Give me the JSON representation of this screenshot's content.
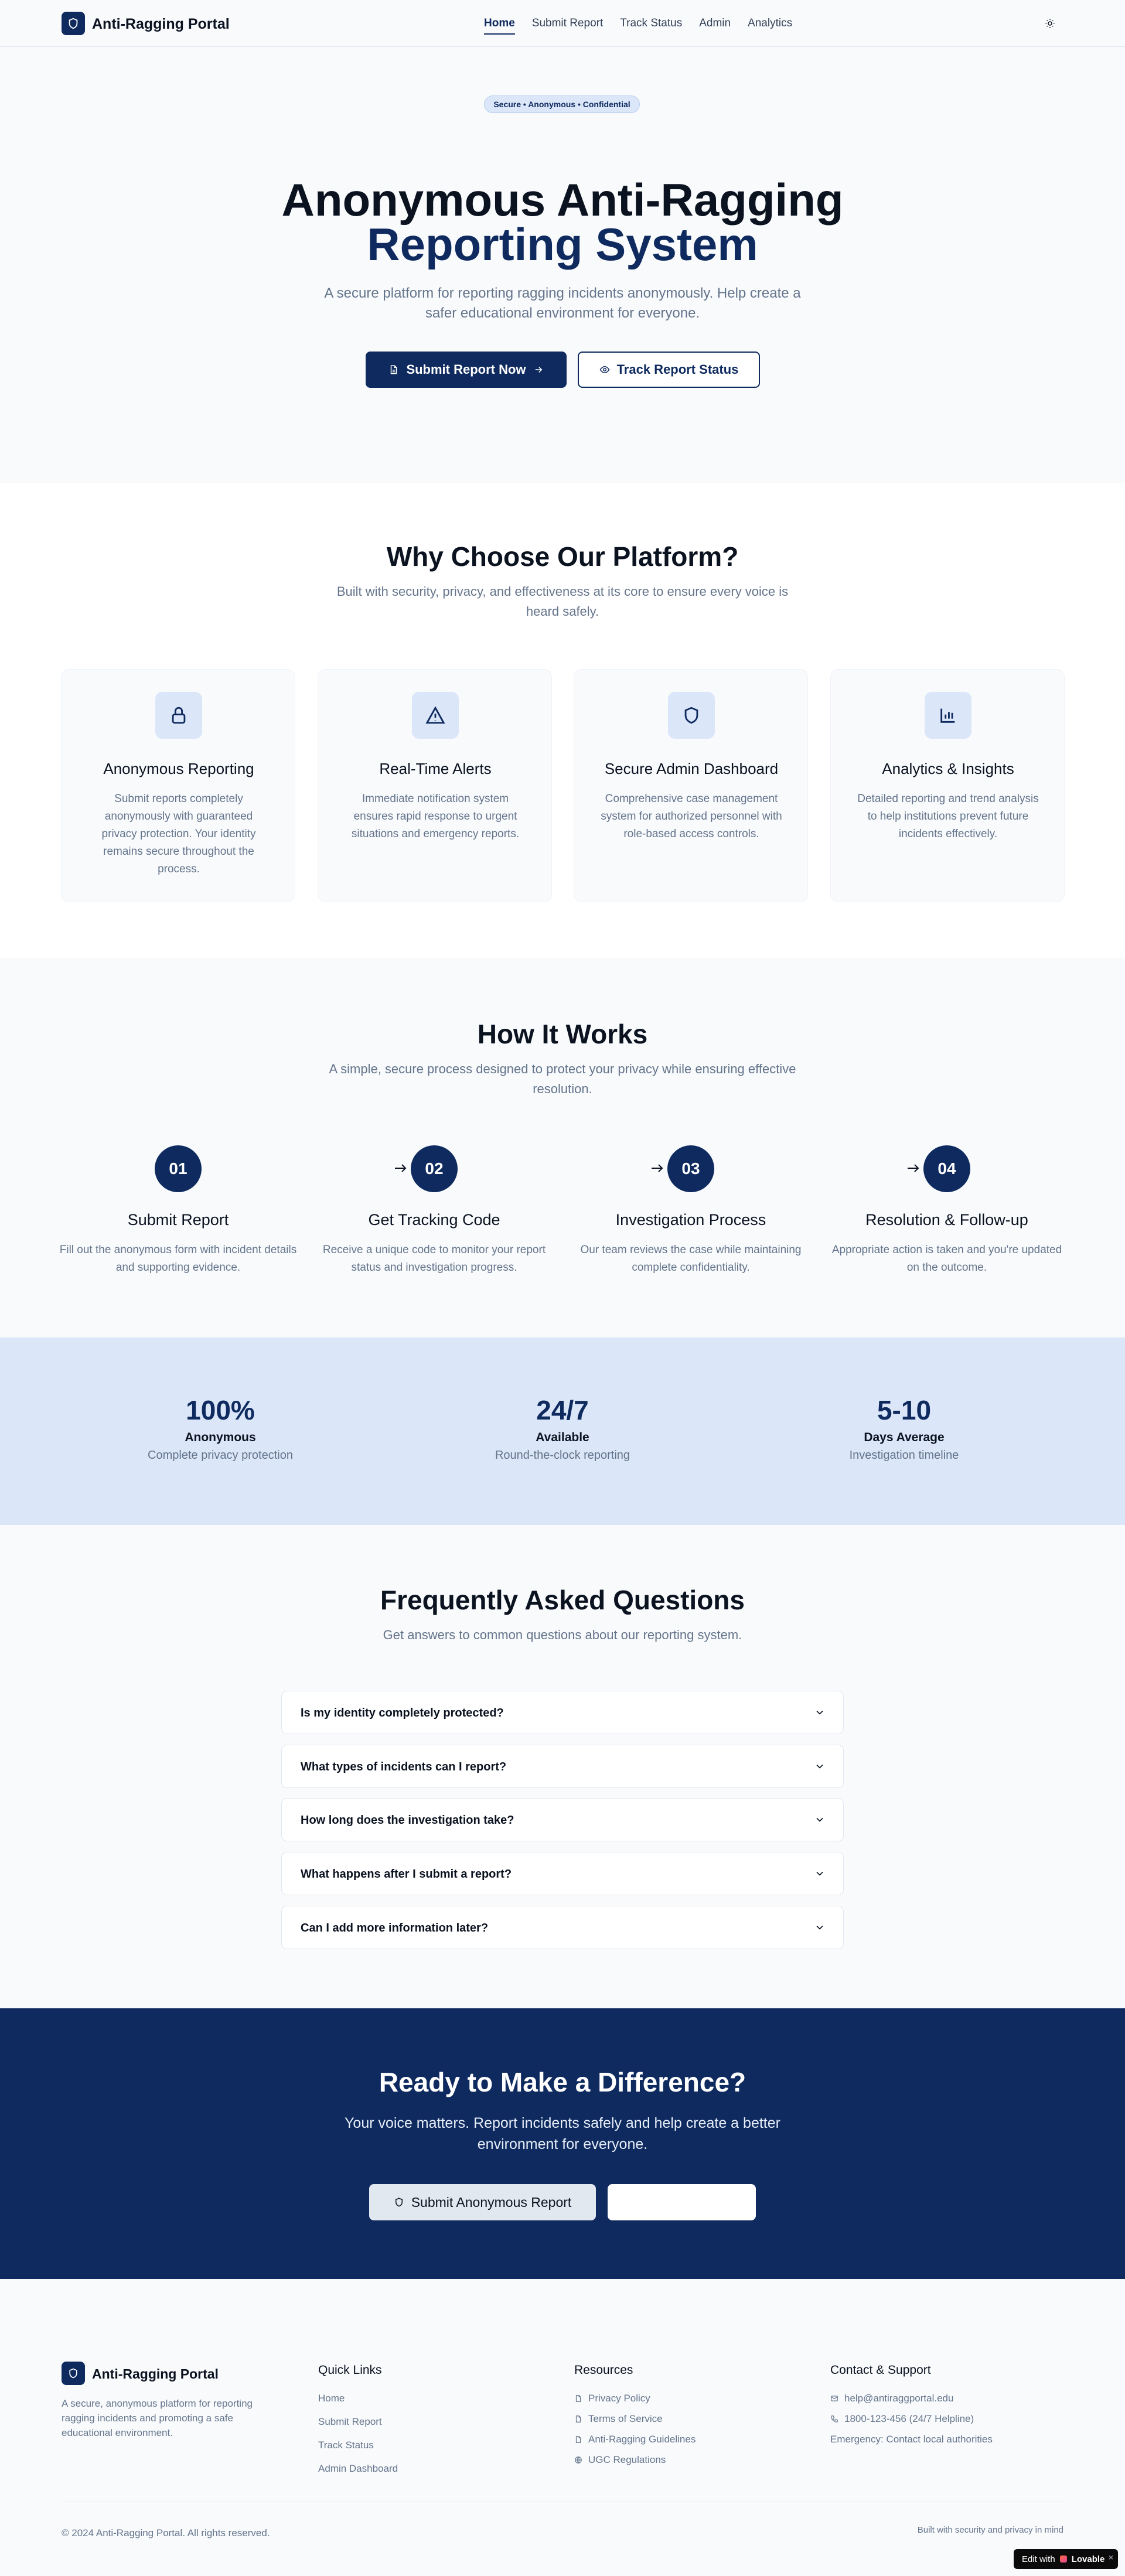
{
  "header": {
    "brand": "Anti-Ragging Portal",
    "logo_icon": "shield-icon",
    "nav": [
      {
        "label": "Home",
        "active": true
      },
      {
        "label": "Submit Report",
        "active": false
      },
      {
        "label": "Track Status",
        "active": false
      },
      {
        "label": "Admin",
        "active": false
      },
      {
        "label": "Analytics",
        "active": false
      }
    ],
    "theme_icon": "sun-icon"
  },
  "hero": {
    "badge": "Secure • Anonymous • Confidential",
    "title_line1": "Anonymous Anti-Ragging",
    "title_line2": "Reporting System",
    "subtitle": "A secure platform for reporting ragging incidents anonymously. Help create a safer educational environment for everyone.",
    "primary_button": "Submit Report Now",
    "secondary_button": "Track Report Status"
  },
  "why": {
    "title": "Why Choose Our Platform?",
    "subtitle": "Built with security, privacy, and effectiveness at its core to ensure every voice is heard safely.",
    "cards": [
      {
        "icon": "lock-icon",
        "title": "Anonymous Reporting",
        "desc": "Submit reports completely anonymously with guaranteed privacy protection. Your identity remains secure throughout the process."
      },
      {
        "icon": "alert-triangle-icon",
        "title": "Real-Time Alerts",
        "desc": "Immediate notification system ensures rapid response to urgent situations and emergency reports."
      },
      {
        "icon": "shield-icon",
        "title": "Secure Admin Dashboard",
        "desc": "Comprehensive case management system for authorized personnel with role-based access controls."
      },
      {
        "icon": "bar-chart-icon",
        "title": "Analytics & Insights",
        "desc": "Detailed reporting and trend analysis to help institutions prevent future incidents effectively."
      }
    ]
  },
  "how": {
    "title": "How It Works",
    "subtitle": "A simple, secure process designed to protect your privacy while ensuring effective resolution.",
    "steps": [
      {
        "num": "01",
        "title": "Submit Report",
        "desc": "Fill out the anonymous form with incident details and supporting evidence."
      },
      {
        "num": "02",
        "title": "Get Tracking Code",
        "desc": "Receive a unique code to monitor your report status and investigation progress."
      },
      {
        "num": "03",
        "title": "Investigation Process",
        "desc": "Our team reviews the case while maintaining complete confidentiality."
      },
      {
        "num": "04",
        "title": "Resolution & Follow-up",
        "desc": "Appropriate action is taken and you're updated on the outcome."
      }
    ]
  },
  "stats": [
    {
      "value": "100%",
      "label": "Anonymous",
      "desc": "Complete privacy protection"
    },
    {
      "value": "24/7",
      "label": "Available",
      "desc": "Round-the-clock reporting"
    },
    {
      "value": "5-10",
      "label": "Days Average",
      "desc": "Investigation timeline"
    }
  ],
  "faq": {
    "title": "Frequently Asked Questions",
    "subtitle": "Get answers to common questions about our reporting system.",
    "items": [
      "Is my identity completely protected?",
      "What types of incidents can I report?",
      "How long does the investigation take?",
      "What happens after I submit a report?",
      "Can I add more information later?"
    ]
  },
  "cta": {
    "title": "Ready to Make a Difference?",
    "subtitle": "Your voice matters. Report incidents safely and help create a better environment for everyone.",
    "primary_button": "Submit Anonymous Report",
    "secondary_button": ""
  },
  "footer": {
    "brand": "Anti-Ragging Portal",
    "desc": "A secure, anonymous platform for reporting ragging incidents and promoting a safe educational environment.",
    "quick_links_title": "Quick Links",
    "quick_links": [
      "Home",
      "Submit Report",
      "Track Status",
      "Admin Dashboard"
    ],
    "resources_title": "Resources",
    "resources": [
      "Privacy Policy",
      "Terms of Service",
      "Anti-Ragging Guidelines",
      "UGC Regulations"
    ],
    "contact_title": "Contact & Support",
    "contact": [
      "help@antiraggportal.edu",
      "1800-123-456 (24/7 Helpline)",
      "Emergency: Contact local authorities"
    ],
    "copyright": "© 2024 Anti-Ragging Portal. All rights reserved.",
    "tagline": "Built with security and privacy in mind"
  },
  "badge": {
    "prefix": "Edit with",
    "brand": "Lovable",
    "close": "×"
  },
  "colors": {
    "primary": "#0e2a5e",
    "accent_light": "#dbe6f8",
    "muted": "#64748b"
  }
}
